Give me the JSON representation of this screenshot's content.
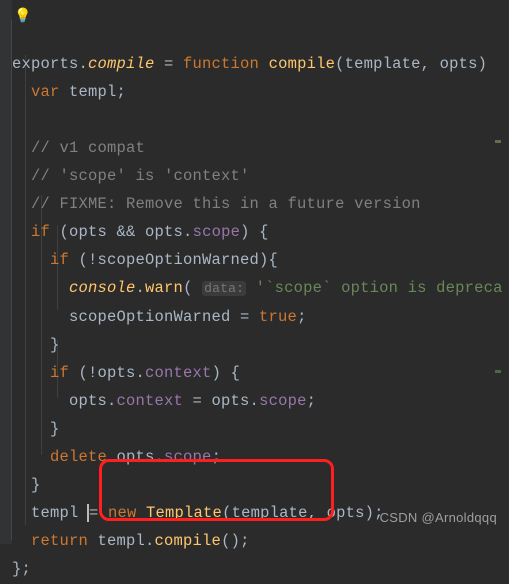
{
  "icons": {
    "bulb": "💡"
  },
  "code": {
    "l1": {
      "a": "exports.",
      "b": "compile",
      "c": " = ",
      "d": "function ",
      "e": "compile",
      "f": "(",
      "g": "template",
      "h": ", ",
      "i": "opts",
      "j": ")"
    },
    "l2": {
      "a": "  ",
      "b": "var ",
      "c": "templ;"
    },
    "l3": "",
    "l4": {
      "a": "  ",
      "b": "// v1 compat"
    },
    "l5": {
      "a": "  ",
      "b": "// 'scope' is 'context'"
    },
    "l6": {
      "a": "  ",
      "b": "// FIXME: Remove this in a future version"
    },
    "l7": {
      "a": "  ",
      "b": "if ",
      "c": "(opts && opts.",
      "d": "scope",
      "e": ") {"
    },
    "l8": {
      "a": "    ",
      "b": "if ",
      "c": "(!scopeOptionWarned){"
    },
    "l9": {
      "a": "      ",
      "b": "console",
      "c": ".",
      "d": "warn",
      "e": "( ",
      "hint": "data:",
      "f": " ",
      "g": "'`scope` option is depreca"
    },
    "l10": {
      "a": "      scopeOptionWarned = ",
      "b": "true",
      "c": ";"
    },
    "l11": "    }",
    "l12": {
      "a": "    ",
      "b": "if ",
      "c": "(!opts.",
      "d": "context",
      "e": ") {"
    },
    "l13": {
      "a": "      opts.",
      "b": "context",
      "c": " = opts.",
      "d": "scope",
      "e": ";"
    },
    "l14": "    }",
    "l15": {
      "a": "    ",
      "b": "delete ",
      "c": "opts.",
      "d": "scope",
      "e": ";"
    },
    "l16": "  }",
    "l17": {
      "a": "  templ ",
      "b": "= ",
      "c": "new ",
      "d": "Template",
      "e": "(template, opts);"
    },
    "l18": {
      "a": "  ",
      "b": "return ",
      "c": "templ.",
      "d": "compile",
      "e": "();"
    },
    "l19": "};"
  },
  "watermark": "CSDN @Arnoldqqq"
}
